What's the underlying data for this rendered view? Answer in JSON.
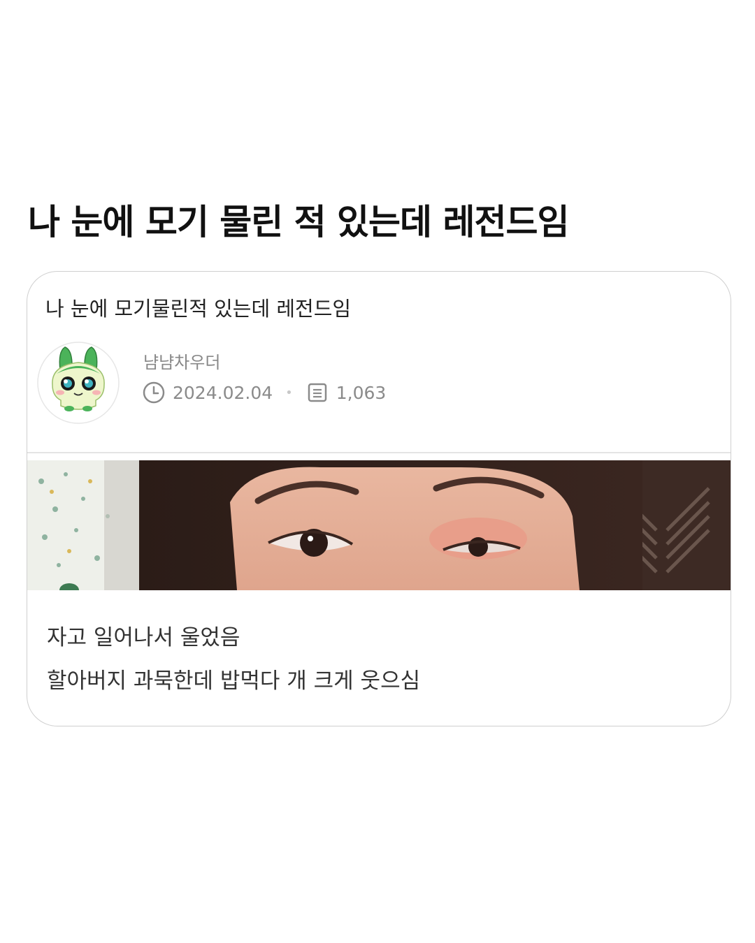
{
  "headline": "나 눈에 모기 물린 적 있는데 레전드임",
  "post": {
    "title": "나 눈에 모기물린적 있는데 레전드임",
    "author": "냠냠차우더",
    "date": "2024.02.04",
    "views": "1,063",
    "body_lines": [
      "자고 일어나서 울었음",
      "할아버지 과묵한데 밥먹다 개 크게 웃으심"
    ]
  },
  "icons": {
    "time": "clock-icon",
    "views": "document-icon"
  }
}
